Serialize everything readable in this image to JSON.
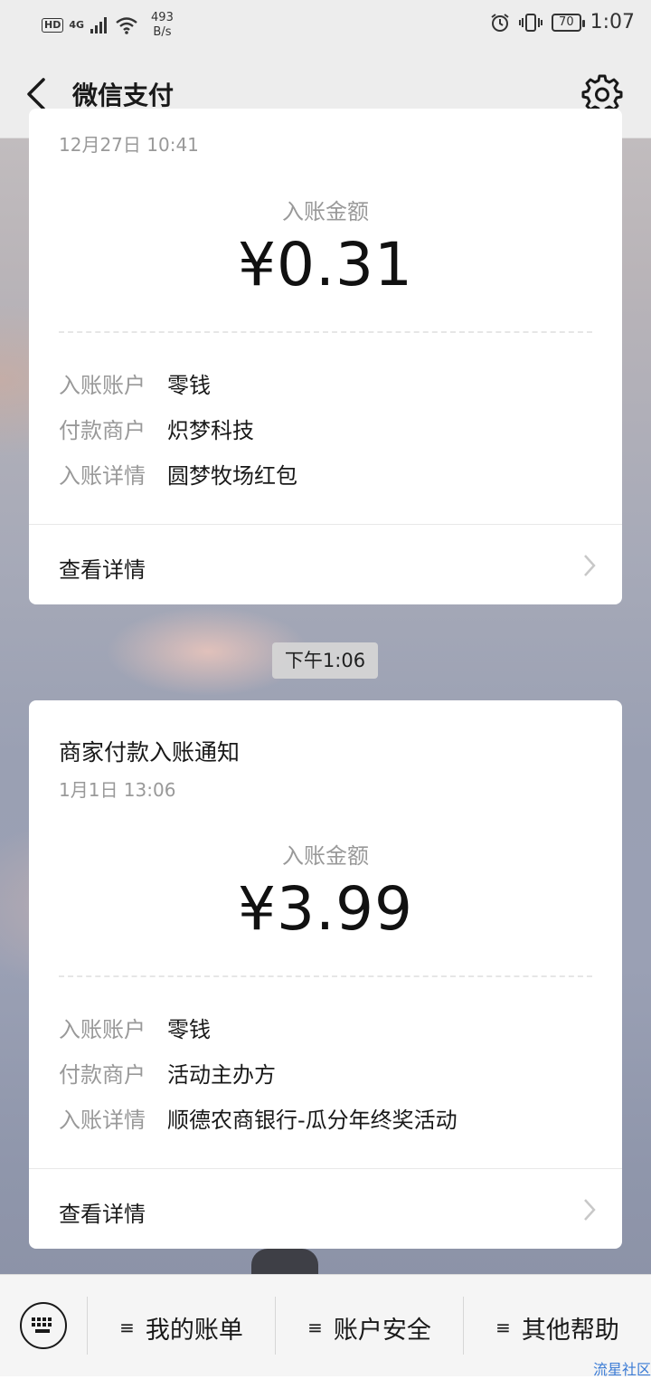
{
  "status_bar": {
    "hd": "HD",
    "signal": "4G",
    "net_speed_value": "493",
    "net_speed_unit": "B/s",
    "battery": "70",
    "time": "1:07"
  },
  "header": {
    "title": "微信支付",
    "back_icon": "chevron-left-icon",
    "settings_icon": "gear-icon"
  },
  "cards": [
    {
      "date": "12月27日  10:41",
      "amount_label": "入账金额",
      "amount": "¥0.31",
      "rows": [
        {
          "key": "入账账户",
          "value": "零钱"
        },
        {
          "key": "付款商户",
          "value": "炽梦科技"
        },
        {
          "key": "入账详情",
          "value": "圆梦牧场红包"
        }
      ],
      "detail_link": "查看详情"
    },
    {
      "title": "商家付款入账通知",
      "date": "1月1日  13:06",
      "amount_label": "入账金额",
      "amount": "¥3.99",
      "rows": [
        {
          "key": "入账账户",
          "value": "零钱"
        },
        {
          "key": "付款商户",
          "value": "活动主办方"
        },
        {
          "key": "入账详情",
          "value": "顺德农商银行-瓜分年终奖活动"
        }
      ],
      "detail_link": "查看详情"
    }
  ],
  "time_separator": "下午1:06",
  "bottom_menu": {
    "keyboard_icon": "keyboard-icon",
    "menu_icon": "≡",
    "items": [
      "我的账单",
      "账户安全",
      "其他帮助"
    ]
  },
  "watermark": "流星社区"
}
